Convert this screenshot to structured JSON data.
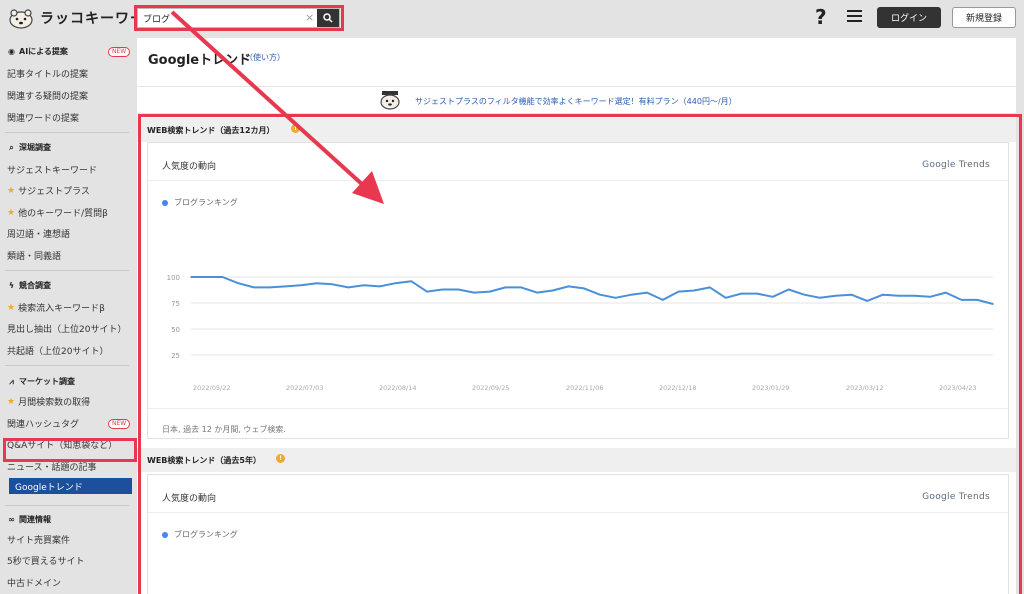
{
  "header": {
    "logo_text": "ラッコキーワード",
    "search_value": "ブログ",
    "login_label": "ログイン",
    "register_label": "新規登録",
    "help_glyph": "?",
    "clear_glyph": "×"
  },
  "sidebar": {
    "ai_section": {
      "title": "AIによる提案",
      "badge": "NEW",
      "items": [
        "記事タイトルの提案",
        "関連する疑問の提案",
        "関連ワードの提案"
      ]
    },
    "deep_section": {
      "title": "深堀調査",
      "items": [
        "サジェストキーワード",
        "サジェストプラス",
        "他のキーワード/質問β",
        "周辺語・連想語",
        "類語・同義語"
      ]
    },
    "competitor_section": {
      "title": "競合調査",
      "items": [
        "検索流入キーワードβ",
        "見出し抽出（上位20サイト）",
        "共起語（上位20サイト）"
      ]
    },
    "market_section": {
      "title": "マーケット調査",
      "items": [
        "月間検索数の取得",
        "関連ハッシュタグ",
        "Q&Aサイト（知恵袋など）",
        "ニュース・話題の記事",
        "Googleトレンド"
      ],
      "badge": "NEW"
    },
    "related_section": {
      "title": "関連情報",
      "items": [
        "サイト売買案件",
        "5秒で買えるサイト",
        "中古ドメイン"
      ]
    }
  },
  "main": {
    "title": "Googleトレンド",
    "usage_link": "（使い方）",
    "promo_text": "サジェストプラスのフィルタ機能で効率よくキーワード選定！有料プラン（440円〜/月）",
    "section1": {
      "title": "WEB検索トレンド（過去12カ月）",
      "card_title": "人気度の動向",
      "google_word": "Google",
      "trends_word": "Trends",
      "legend": "ブログランキング",
      "footer": "日本, 過去 12 か月間, ウェブ検索."
    },
    "section2": {
      "title": "WEB検索トレンド（過去5年）",
      "card_title": "人気度の動向",
      "google_word": "Google",
      "trends_word": "Trends",
      "legend": "ブログランキング"
    }
  },
  "colors": {
    "highlight": "#e8384f",
    "active_nav": "#1c4f9c",
    "line": "#4a90d9",
    "star": "#f0a830"
  },
  "chart_data": {
    "type": "line",
    "series": [
      {
        "name": "ブログランキング",
        "values": [
          100,
          100,
          100,
          94,
          90,
          90,
          91,
          92,
          94,
          93,
          90,
          92,
          91,
          94,
          96,
          86,
          88,
          88,
          85,
          86,
          90,
          90,
          85,
          87,
          91,
          89,
          83,
          80,
          83,
          85,
          78,
          86,
          87,
          90,
          80,
          84,
          84,
          81,
          88,
          83,
          80,
          82,
          83,
          77,
          83,
          82,
          82,
          81,
          85,
          78,
          78,
          74
        ]
      }
    ],
    "x_tick_labels": [
      "2022/05/22",
      "2022/07/03",
      "2022/08/14",
      "2022/09/25",
      "2022/11/06",
      "2022/12/18",
      "2023/01/29",
      "2023/03/12",
      "2023/04/23"
    ],
    "y_tick_labels": [
      "100",
      "75",
      "50",
      "25"
    ],
    "ylim": [
      0,
      100
    ],
    "grid": true,
    "legend": "top-left"
  }
}
